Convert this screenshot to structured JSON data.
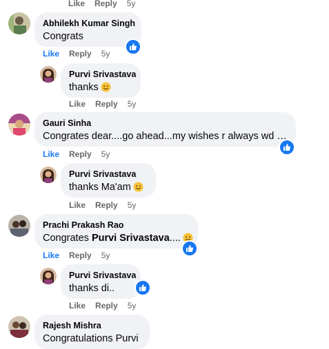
{
  "labels": {
    "like": "Like",
    "reply": "Reply"
  },
  "colors": {
    "bubble": "#f0f2f5",
    "link_blue": "#1877f2",
    "muted": "#65676b"
  },
  "top_actions": {
    "like": "Like",
    "reply": "Reply",
    "time": "5y"
  },
  "comments": [
    {
      "author": "Abhilekh Kumar Singh",
      "text": "Congrats",
      "time": "5y",
      "liked": true,
      "reply": {
        "author": "Purvi Srivastava",
        "text": "thanks",
        "emoji": "smile",
        "time": "5y"
      }
    },
    {
      "author": "Gauri Sinha",
      "text": "Congrates dear....go ahead...my wishes r always wd u...",
      "time": "5y",
      "liked": true,
      "reply": {
        "author": "Purvi Srivastava",
        "text": "thanks Ma'am",
        "emoji": "smile",
        "time": "5y"
      }
    },
    {
      "author": "Prachi Prakash Rao",
      "text": "Congrates ",
      "mention": "Purvi Srivastava",
      "tail": "....",
      "emoji": "smile",
      "time": "5y",
      "liked": true,
      "reply": {
        "author": "Purvi Srivastava",
        "text": "thanks di..",
        "time": "5y",
        "liked": true
      }
    },
    {
      "author": "Rajesh Mishra",
      "text": "Congratulations Purvi"
    }
  ]
}
